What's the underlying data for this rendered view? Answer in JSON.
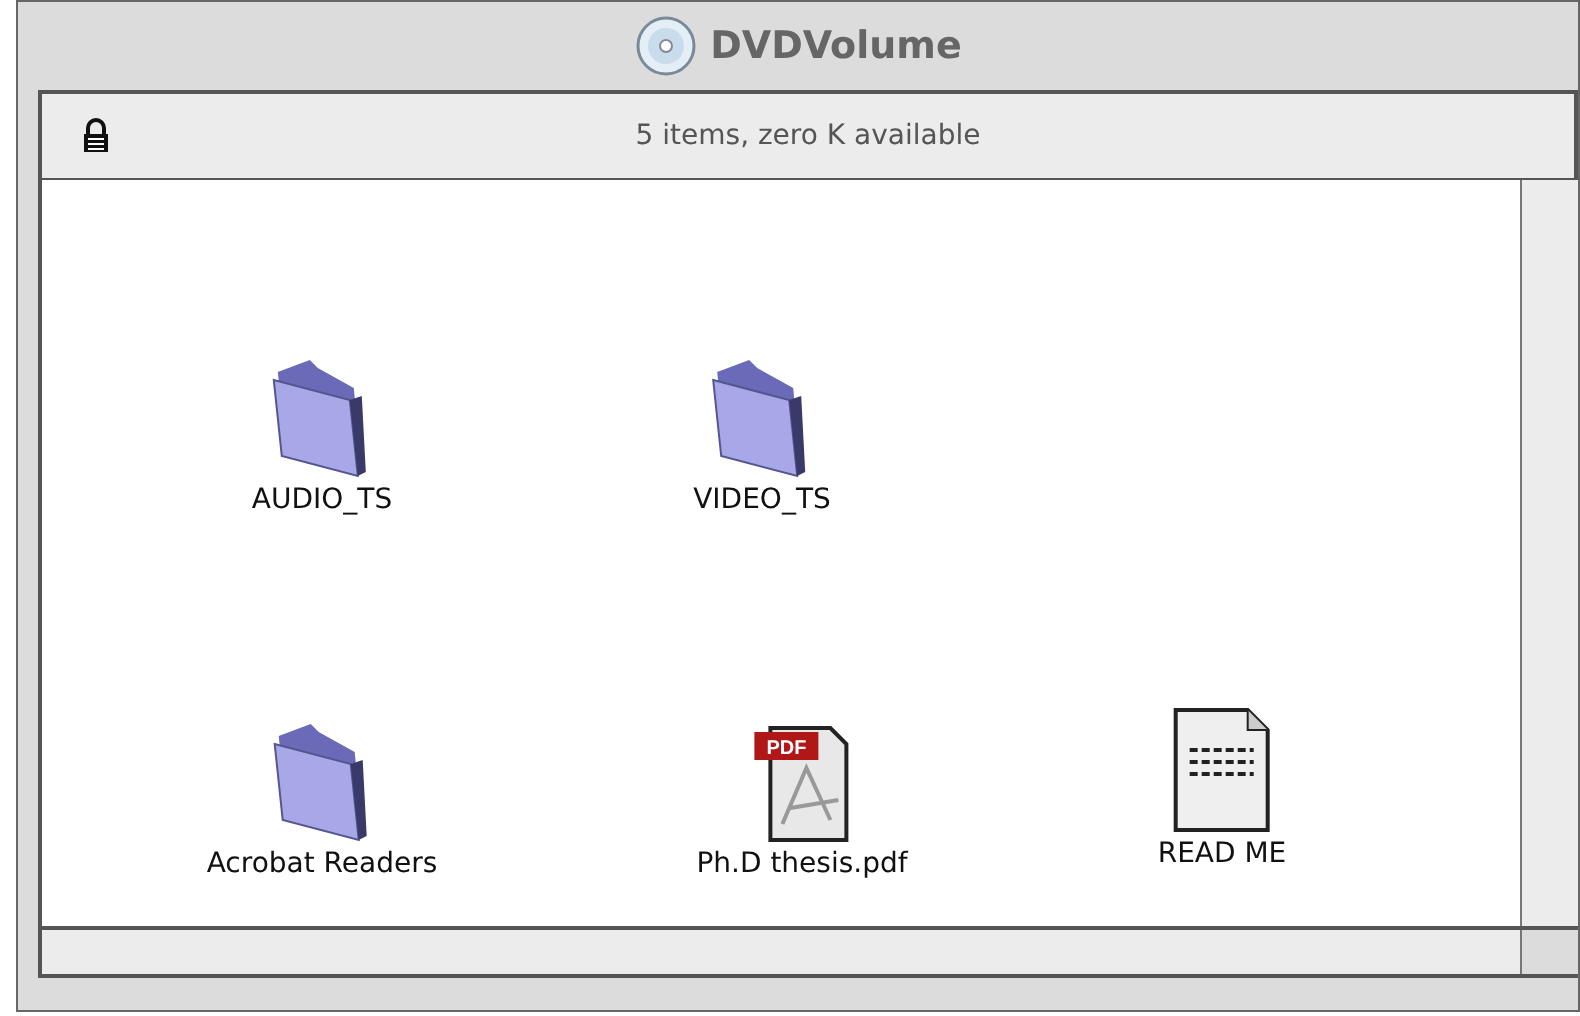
{
  "window": {
    "title": "DVDVolume"
  },
  "info_bar": {
    "locked": true,
    "text": "5 items, zero K available"
  },
  "items": [
    {
      "kind": "folder",
      "name": "AUDIO_TS"
    },
    {
      "kind": "folder",
      "name": "VIDEO_TS"
    },
    {
      "kind": "folder",
      "name": "Acrobat Readers"
    },
    {
      "kind": "pdf",
      "name": "Ph.D thesis.pdf",
      "badge": "PDF"
    },
    {
      "kind": "text",
      "name": "READ ME"
    }
  ]
}
